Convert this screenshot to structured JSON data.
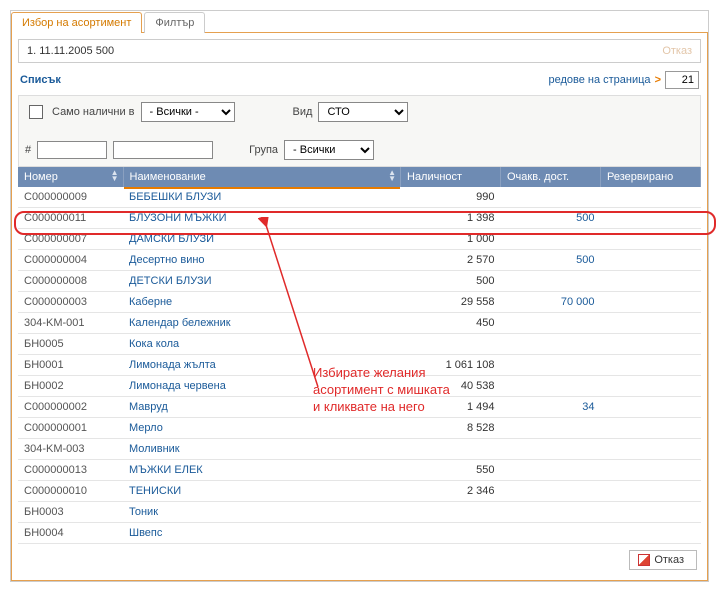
{
  "tabs": {
    "active": "Избор на асортимент",
    "inactive": "Филтър"
  },
  "title_line": "1.  11.11.2005  500",
  "title_cancel": "Отказ",
  "list": {
    "title": "Списък",
    "rows_label": "редове на страница",
    "rows_value": "21"
  },
  "filters": {
    "only_available_label": "Само налични в",
    "only_available_select": "- Всички -",
    "type_label": "Вид",
    "type_select": "СТО",
    "hash_label": "#",
    "group_label": "Група",
    "group_select": "- Всички -"
  },
  "columns": {
    "code": "Номер",
    "name": "Наименование",
    "avail": "Наличност",
    "expect": "Очакв. дост.",
    "res": "Резервирано"
  },
  "rows": [
    {
      "code": "C000000009",
      "name": "БЕБЕШКИ БЛУЗИ",
      "avail": "990",
      "expect": "",
      "res": ""
    },
    {
      "code": "C000000011",
      "name": "БЛУЗОНИ МЪЖКИ",
      "avail": "1 398",
      "expect": "500",
      "res": ""
    },
    {
      "code": "C000000007",
      "name": "ДАМСКИ БЛУЗИ",
      "avail": "1 000",
      "expect": "",
      "res": ""
    },
    {
      "code": "C000000004",
      "name": "Десертно вино",
      "avail": "2 570",
      "expect": "500",
      "res": ""
    },
    {
      "code": "C000000008",
      "name": "ДЕТСКИ БЛУЗИ",
      "avail": "500",
      "expect": "",
      "res": ""
    },
    {
      "code": "C000000003",
      "name": "Каберне",
      "avail": "29 558",
      "expect": "70 000",
      "res": ""
    },
    {
      "code": "304-KM-001",
      "name": "Календар бележник",
      "avail": "450",
      "expect": "",
      "res": ""
    },
    {
      "code": "БН0005",
      "name": "Кока кола",
      "avail": "",
      "expect": "",
      "res": ""
    },
    {
      "code": "БН0001",
      "name": "Лимонада жълта",
      "avail": "1 061 108",
      "expect": "",
      "res": ""
    },
    {
      "code": "БН0002",
      "name": "Лимонада червена",
      "avail": "40 538",
      "expect": "",
      "res": ""
    },
    {
      "code": "C000000002",
      "name": "Мавруд",
      "avail": "1 494",
      "expect": "34",
      "res": ""
    },
    {
      "code": "C000000001",
      "name": "Мерло",
      "avail": "8 528",
      "expect": "",
      "res": ""
    },
    {
      "code": "304-KM-003",
      "name": "Моливник",
      "avail": "",
      "expect": "",
      "res": ""
    },
    {
      "code": "C000000013",
      "name": "МЪЖКИ ЕЛЕК",
      "avail": "550",
      "expect": "",
      "res": ""
    },
    {
      "code": "C000000010",
      "name": "ТЕНИСКИ",
      "avail": "2 346",
      "expect": "",
      "res": ""
    },
    {
      "code": "БН0003",
      "name": "Тоник",
      "avail": "",
      "expect": "",
      "res": ""
    },
    {
      "code": "БН0004",
      "name": "Швепс",
      "avail": "",
      "expect": "",
      "res": ""
    }
  ],
  "annotation": "Избирате желания\nасортимент с мишката\nи кликвате на него",
  "footer_cancel": "Отказ"
}
